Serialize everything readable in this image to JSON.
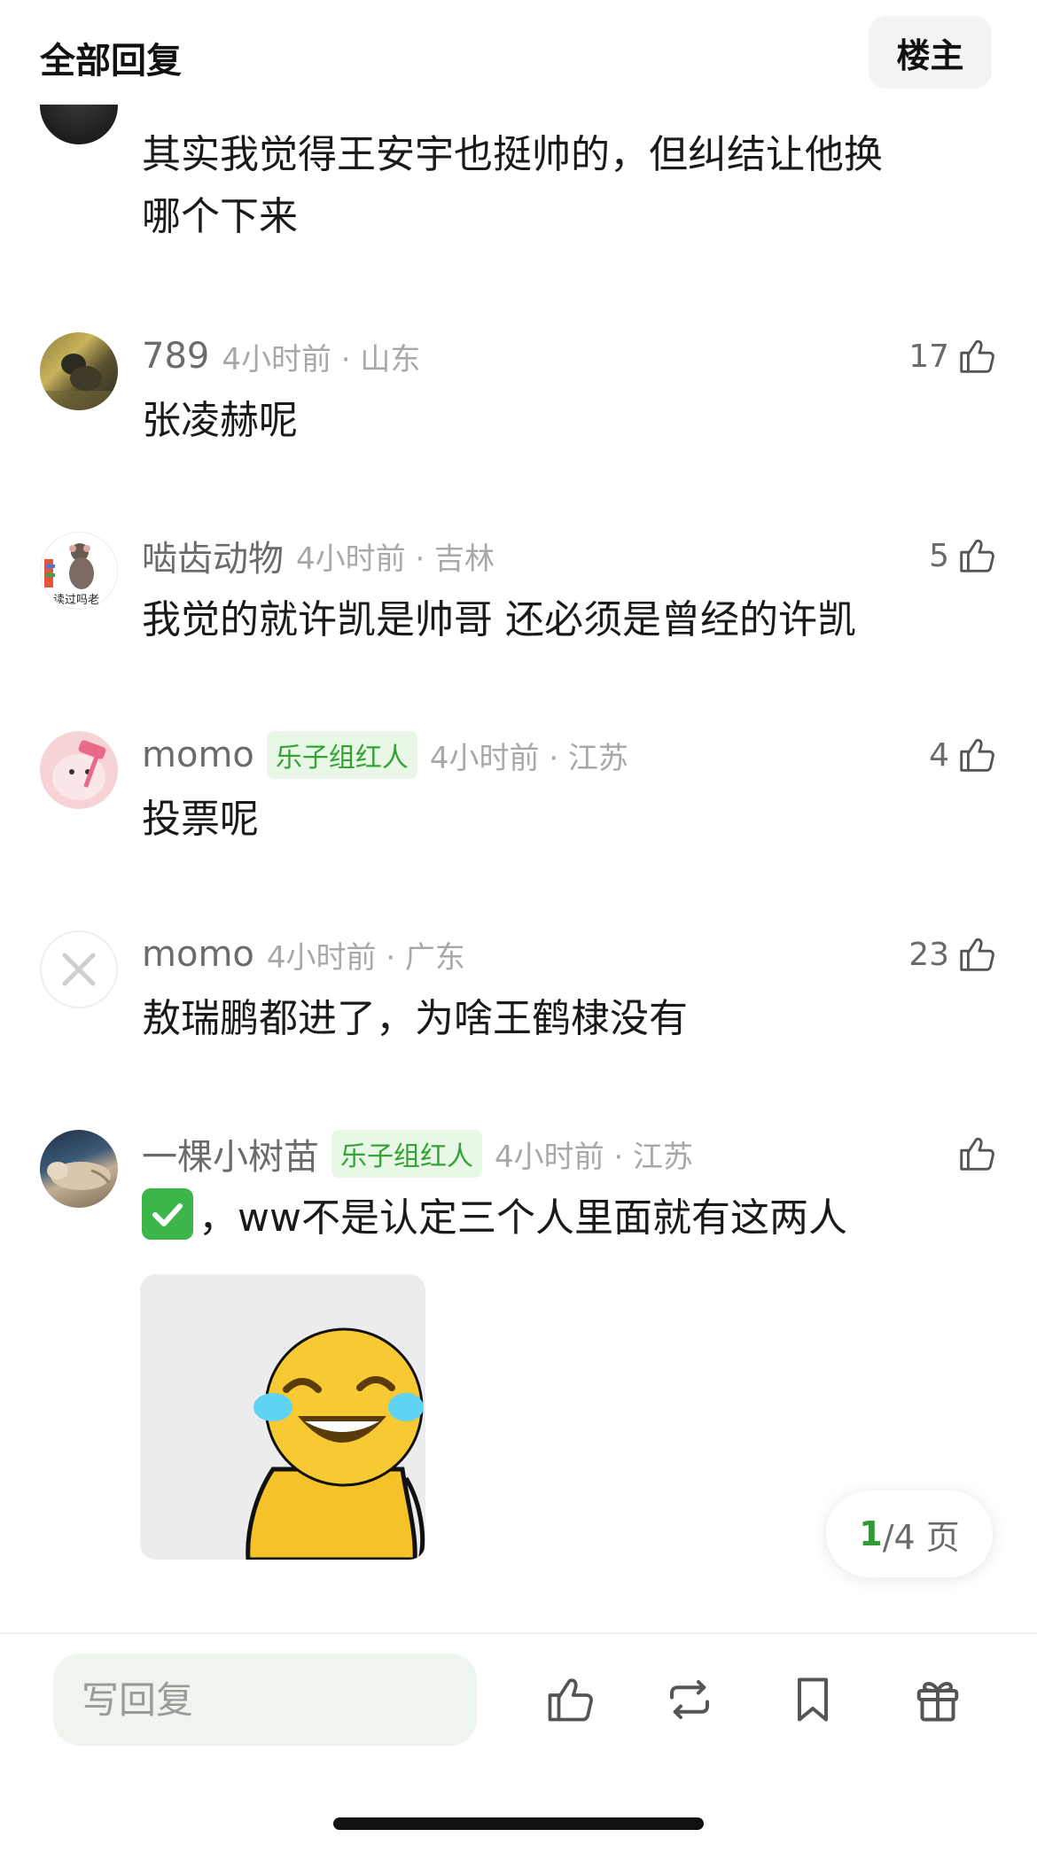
{
  "header": {
    "title": "全部回复",
    "owner_label": "楼主"
  },
  "comments": [
    {
      "username": "",
      "badge": "",
      "time": "",
      "likes": "",
      "text_line1": "其实我觉得王安宇也挺帅的，但纠结让他换",
      "text_line2": "哪个下来"
    },
    {
      "username": "789",
      "time": "4小时前 · 山东",
      "likes": "17",
      "text": "张凌赫呢"
    },
    {
      "username": "啮齿动物",
      "time": "4小时前 · 吉林",
      "likes": "5",
      "text": "我觉的就许凯是帅哥 还必须是曾经的许凯",
      "avatar_caption": "读过吗老"
    },
    {
      "username": "momo",
      "badge": "乐子组红人",
      "time": "4小时前 · 江苏",
      "likes": "4",
      "text": "投票呢"
    },
    {
      "username": "momo",
      "time": "4小时前 · 广东",
      "likes": "23",
      "text": "敖瑞鹏都进了，为啥王鹤棣没有"
    },
    {
      "username": "一棵小树苗",
      "badge": "乐子组红人",
      "time": "4小时前 · 江苏",
      "likes": "",
      "text": "，ww不是认定三个人里面就有这两人",
      "emoji": "check-mark-button"
    }
  ],
  "pager": {
    "current": "1",
    "total": "/4 页"
  },
  "bottom_bar": {
    "reply_placeholder": "写回复",
    "icons": [
      "thumbs-up-icon",
      "repost-icon",
      "bookmark-icon",
      "gift-icon"
    ]
  },
  "colors": {
    "badge_bg": "#e9f8e6",
    "badge_text": "#34a336",
    "pager_current": "#2f9a36",
    "input_bg": "#eef5ee"
  }
}
